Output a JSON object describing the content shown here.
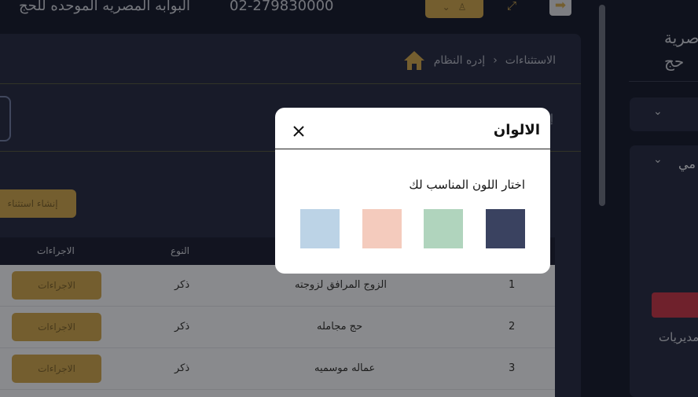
{
  "header": {
    "site_title": "البوابه المصريه الموحده للحج",
    "phone": "02-279830000",
    "user_button_icon": "user-icon",
    "expand_icon": "expand-icon",
    "menu_toggle_icon": "arrow-right-icon"
  },
  "breadcrumb": {
    "home_icon": "home-icon",
    "items": [
      "إدره النظام",
      "الاستثناءات"
    ]
  },
  "page": {
    "create_button": "إنشاء استثناء",
    "edge_char": "إ"
  },
  "table": {
    "columns": {
      "number": "",
      "name": "",
      "type": "النوع",
      "actions": "الاجراءات"
    },
    "rows": [
      {
        "number": "1",
        "name": "الزوج المرافق لزوجته",
        "type": "ذكر",
        "action": "الاجراءات"
      },
      {
        "number": "2",
        "name": "حج مجامله",
        "type": "ذكر",
        "action": "الاجراءات"
      },
      {
        "number": "3",
        "name": "عماله موسميه",
        "type": "ذكر",
        "action": "الاجراءات"
      }
    ]
  },
  "sidebar": {
    "title_line1": "صرية",
    "title_line2": "حج",
    "item2_label": "مي",
    "link_text": "مديريات"
  },
  "modal": {
    "title": "الالوان",
    "prompt": "اختار اللون المناسب لك",
    "close_icon": "close-icon",
    "swatches": [
      {
        "name": "navy",
        "color": "#3a4260"
      },
      {
        "name": "green",
        "color": "#b0d4bd"
      },
      {
        "name": "peach",
        "color": "#f4cbbd"
      },
      {
        "name": "light-blue",
        "color": "#bcd3e6"
      }
    ]
  },
  "colors": {
    "accent_gold": "#c9a352",
    "background_dark": "#1b1f33",
    "panel": "#2a3047",
    "danger": "#c0394d"
  }
}
